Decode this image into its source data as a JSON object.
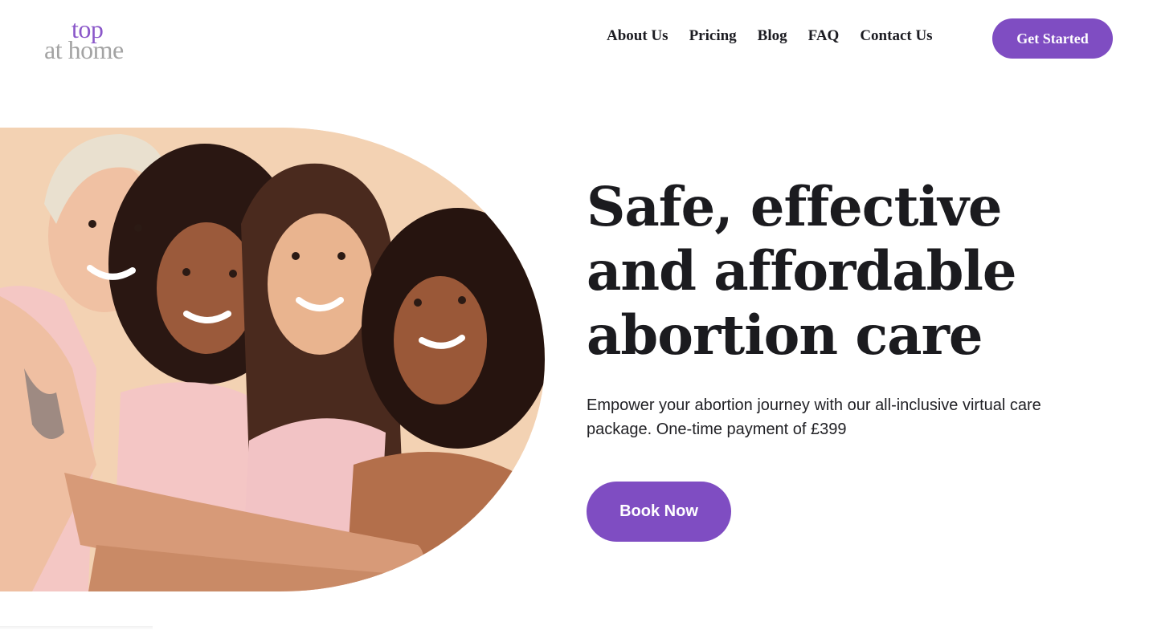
{
  "brand": {
    "line1": "top",
    "line2": "at home",
    "primary_color": "#7f4dc2",
    "logo_gray": "#a3a3a3"
  },
  "nav": {
    "items": [
      {
        "label": "About Us"
      },
      {
        "label": "Pricing"
      },
      {
        "label": "Blog"
      },
      {
        "label": "FAQ"
      },
      {
        "label": "Contact Us"
      }
    ],
    "cta_label": "Get Started"
  },
  "hero": {
    "headline_lines": [
      "Safe, effective",
      "and affordable",
      "abortion care"
    ],
    "subtext": "Empower your abortion journey with our all-inclusive virtual care package. One-time payment of £399",
    "cta_label": "Book Now",
    "image_icon": "group-of-four-smiling-women-photo"
  }
}
